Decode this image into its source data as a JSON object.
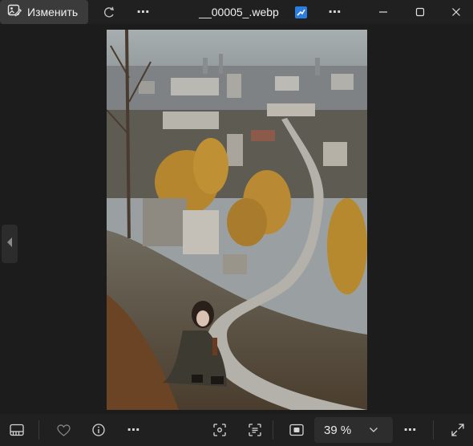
{
  "toolbar": {
    "edit_label": "Изменить",
    "more_icon": "⋯"
  },
  "window": {
    "title": "__00005_.webp"
  },
  "bottom": {
    "zoom_value": "39 %"
  },
  "colors": {
    "background": "#1c1c1c",
    "bar": "#202020",
    "edit_button": "#3b3b3b",
    "accent": "#2b7de0"
  }
}
